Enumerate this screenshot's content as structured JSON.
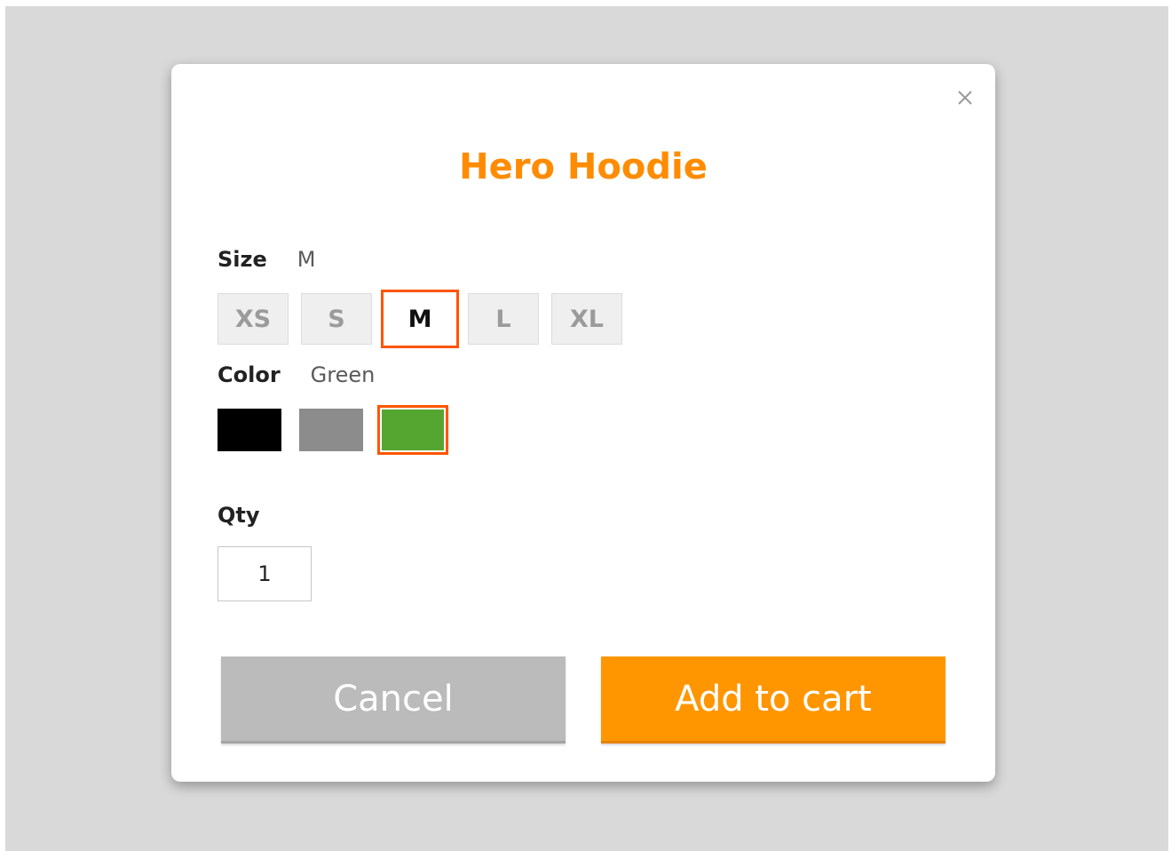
{
  "product": {
    "title": "Hero Hoodie"
  },
  "size": {
    "label": "Size",
    "selected": "M",
    "options": [
      "XS",
      "S",
      "M",
      "L",
      "XL"
    ]
  },
  "color": {
    "label": "Color",
    "selected": "Green",
    "options": [
      {
        "name": "Black",
        "hex": "#000000"
      },
      {
        "name": "Gray",
        "hex": "#8c8c8c"
      },
      {
        "name": "Green",
        "hex": "#55a630"
      }
    ]
  },
  "qty": {
    "label": "Qty",
    "value": "1"
  },
  "actions": {
    "cancel_label": "Cancel",
    "add_label": "Add to cart"
  },
  "theme": {
    "accent": "#ff8c00",
    "selected_border": "#ff5500",
    "cancel_bg": "#bbbbbb",
    "add_bg": "#ff9600",
    "backdrop": "#d9d9d9"
  },
  "icons": {
    "close": "close-icon"
  }
}
